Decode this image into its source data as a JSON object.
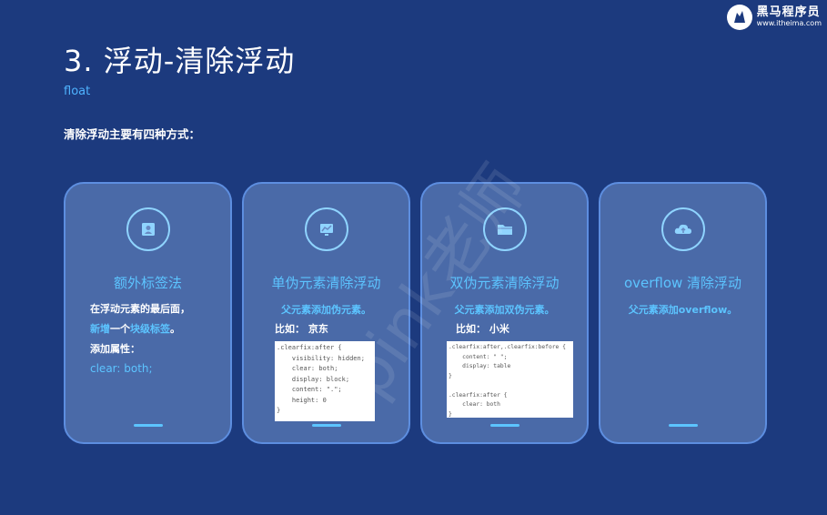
{
  "logo": {
    "name": "黑马程序员",
    "url": "www.itheima.com"
  },
  "title": "3. 浮动-清除浮动",
  "subtitle": "float",
  "intro": "清除浮动主要有四种方式：",
  "watermark": "pink老师",
  "accent_color": "#5cc4ff",
  "cards": [
    {
      "icon": "id-card-icon",
      "title": "额外标签法",
      "lines": [
        "在浮动元素的最后面，",
        "新增",
        "一个",
        "块级标签",
        "。",
        "添加属性：",
        "clear: both;"
      ]
    },
    {
      "icon": "chart-monitor-icon",
      "title": "单伪元素清除浮动",
      "desc": "父元素添加伪元素。",
      "example": "比如： 京东",
      "code": ".clearfix:after {\n    visibility: hidden;\n    clear: both;\n    display: block;\n    content: \".\";\n    height: 0\n}"
    },
    {
      "icon": "folder-icon",
      "title": "双伪元素清除浮动",
      "desc": "父元素添加双伪元素。",
      "example": "比如： 小米",
      "code": ".clearfix:after,.clearfix:before {\n    content: \" \";\n    display: table\n}\n\n.clearfix:after {\n    clear: both\n}"
    },
    {
      "icon": "cloud-upload-icon",
      "title": "overflow 清除浮动",
      "desc": "父元素添加overflow。"
    }
  ]
}
